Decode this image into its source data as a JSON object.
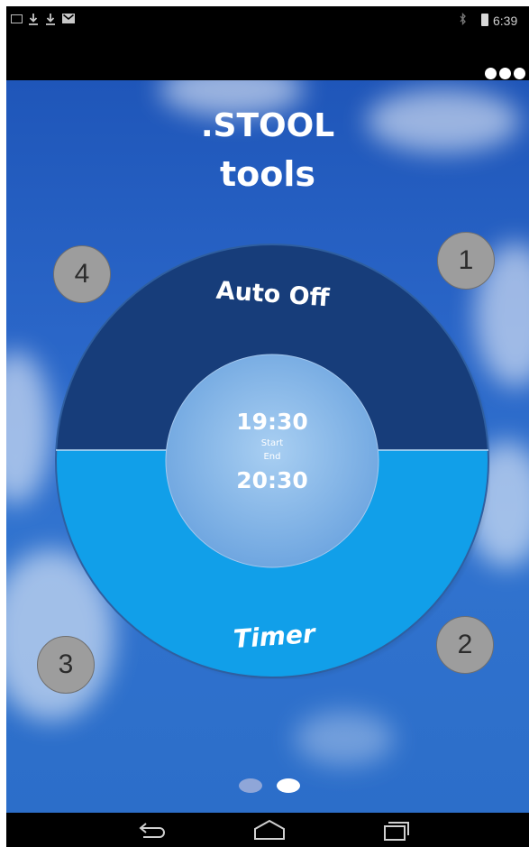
{
  "status_bar": {
    "time": "6:39",
    "left_icons": [
      "image-icon",
      "download-icon",
      "download-icon",
      "gmail-icon"
    ],
    "right_icons": [
      "bluetooth-icon",
      "battery-icon"
    ]
  },
  "action_bar": {
    "overflow_icon": "more-dots-icon"
  },
  "header": {
    "title_line1": ".STOOL",
    "title_line2": "tools"
  },
  "dial": {
    "top_label": "Auto Off",
    "bottom_label": "Timer",
    "start_time": "19:30",
    "start_label": "Start",
    "end_label": "End",
    "end_time": "20:30",
    "colors": {
      "top": "#173d7a",
      "bottom": "#119fe9",
      "center": "#7fb3e8"
    }
  },
  "callouts": [
    "1",
    "2",
    "3",
    "4"
  ],
  "page_indicator": {
    "pages": 2,
    "active_page": 2
  },
  "nav_bar": {
    "icons": [
      "back-icon",
      "home-icon",
      "recents-icon"
    ]
  }
}
